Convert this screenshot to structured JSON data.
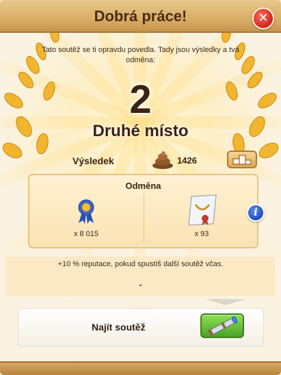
{
  "dialog": {
    "title": "Dobrá práce!",
    "close_icon": "close-icon"
  },
  "intro_text": "Tato soutěž se ti opravdu povedla. Tady jsou výsledky a tvá odměna:",
  "rank": {
    "number": "2",
    "label": "Druhé místo"
  },
  "result": {
    "label": "Výsledek",
    "value": "1426",
    "icon": "manure-pile-icon",
    "ranking_icon": "podium-icon"
  },
  "reward": {
    "title": "Odměna",
    "items": [
      {
        "icon": "ribbon-medal-icon",
        "quantity": "x 8 015"
      },
      {
        "icon": "certificate-scroll-icon",
        "quantity": "x 93"
      }
    ],
    "info_icon": "info-icon"
  },
  "bonus": {
    "text": "+10 % reputace, pokud spustíš další soutěž včas.",
    "value": "-"
  },
  "find_contest": {
    "label": "Najít soutěž",
    "button_icon": "telescope-icon"
  },
  "colors": {
    "wood": "#d8ad66",
    "title_text": "#4a2c12",
    "close_red": "#d2241a",
    "find_green": "#4aa425",
    "info_blue": "#1c47b4"
  }
}
